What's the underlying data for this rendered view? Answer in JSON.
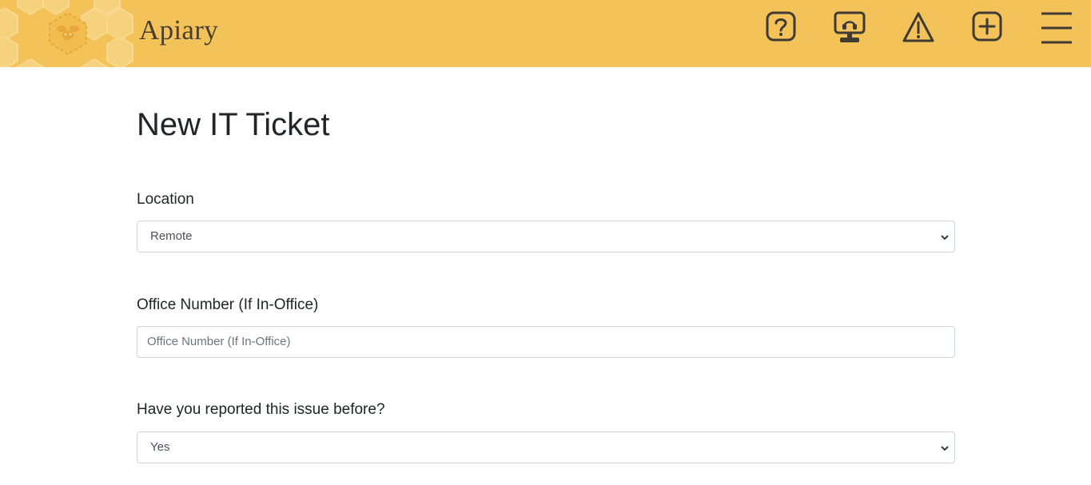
{
  "header": {
    "brand": "Apiary",
    "icons": [
      "help-icon",
      "support-monitor-icon",
      "warning-icon",
      "add-icon",
      "menu-icon"
    ],
    "colors": {
      "background": "#f3c35a",
      "icon": "#3f3a33"
    }
  },
  "page": {
    "title": "New IT Ticket"
  },
  "form": {
    "location": {
      "label": "Location",
      "selected": "Remote"
    },
    "office_number": {
      "label": "Office Number (If In-Office)",
      "placeholder": "Office Number (If In-Office)",
      "value": ""
    },
    "reported_before": {
      "label": "Have you reported this issue before?",
      "selected": "Yes"
    }
  }
}
